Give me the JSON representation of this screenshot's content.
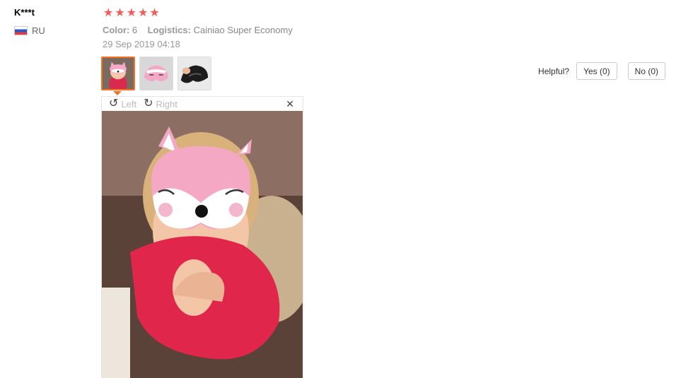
{
  "review": {
    "user": "K***t",
    "country_code": "RU",
    "rating": 5,
    "stars": [
      "★",
      "★",
      "★",
      "★",
      "★"
    ],
    "color_label": "Color:",
    "color_value": "6",
    "logistics_label": "Logistics:",
    "logistics_value": "Cainiao Super Economy",
    "date": "29 Sep 2019 04:18"
  },
  "viewer": {
    "left_label": "Left",
    "right_label": "Right",
    "close_glyph": "✕",
    "rotate_left_glyph": "↺",
    "rotate_right_glyph": "↻"
  },
  "helpful": {
    "label": "Helpful?",
    "yes": "Yes (0)",
    "no": "No (0)"
  },
  "colors": {
    "star": "#f35b57",
    "active_thumb": "#f57224"
  }
}
